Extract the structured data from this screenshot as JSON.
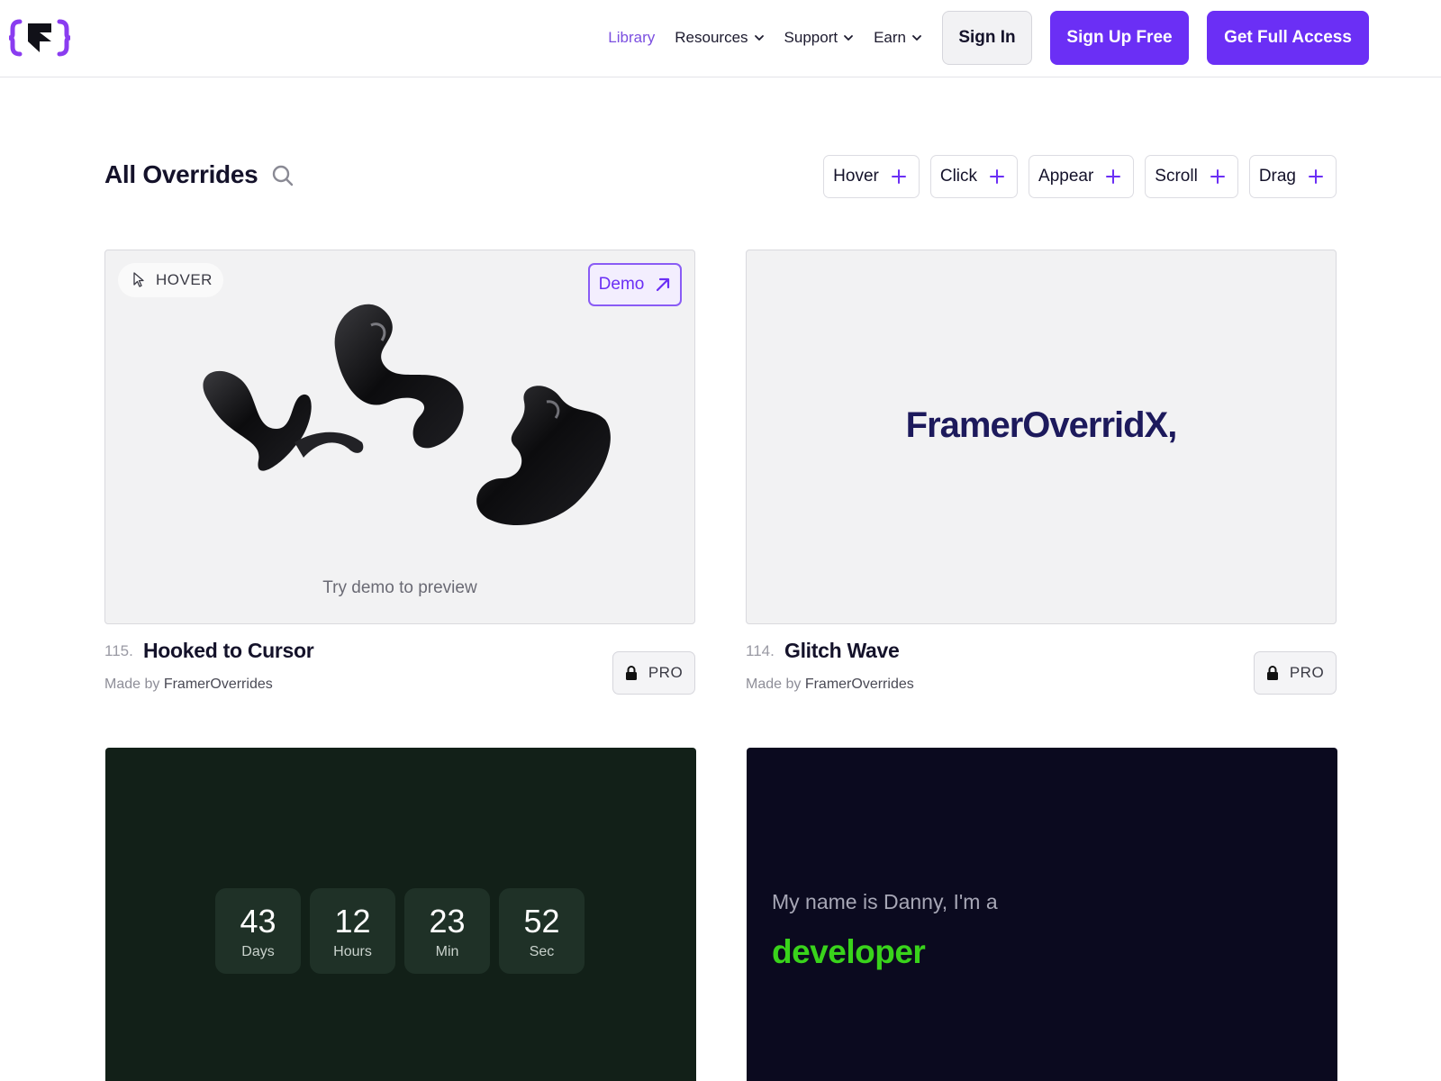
{
  "nav": {
    "links": [
      {
        "label": "Library",
        "active": true,
        "dropdown": false
      },
      {
        "label": "Resources",
        "active": false,
        "dropdown": true
      },
      {
        "label": "Support",
        "active": false,
        "dropdown": true
      },
      {
        "label": "Earn",
        "active": false,
        "dropdown": true
      }
    ],
    "sign_in": "Sign In",
    "sign_up": "Sign Up Free",
    "full_access": "Get Full Access"
  },
  "library": {
    "title": "All Overrides",
    "filters": [
      "Hover",
      "Click",
      "Appear",
      "Scroll",
      "Drag"
    ]
  },
  "cards": [
    {
      "number": "115.",
      "title": "Hooked to Cursor",
      "made_by_prefix": "Made by",
      "author": "FramerOverrides",
      "badge": "PRO",
      "tag": "HOVER",
      "demo_label": "Demo",
      "preview_hint": "Try demo to preview"
    },
    {
      "number": "114.",
      "title": "Glitch Wave",
      "made_by_prefix": "Made by",
      "author": "FramerOverrides",
      "badge": "PRO",
      "preview_text": "FramerOverridX,"
    },
    {
      "countdown": [
        {
          "value": "43",
          "unit": "Days"
        },
        {
          "value": "12",
          "unit": "Hours"
        },
        {
          "value": "23",
          "unit": "Min"
        },
        {
          "value": "52",
          "unit": "Sec"
        }
      ]
    },
    {
      "line": "My name is Danny, I'm a",
      "word": "developer"
    }
  ],
  "colors": {
    "accent": "#6b2ff5",
    "accent_text": "#7b4fe0",
    "glitch_text": "#1d1a5c",
    "countdown_bg": "#122018",
    "typing_bg": "#0b0a1f",
    "typing_word": "#39d31b"
  },
  "icons": [
    "logo-icon",
    "chevron-down-icon",
    "search-icon",
    "plus-icon",
    "cursor-icon",
    "arrow-up-right-icon",
    "lock-icon"
  ]
}
